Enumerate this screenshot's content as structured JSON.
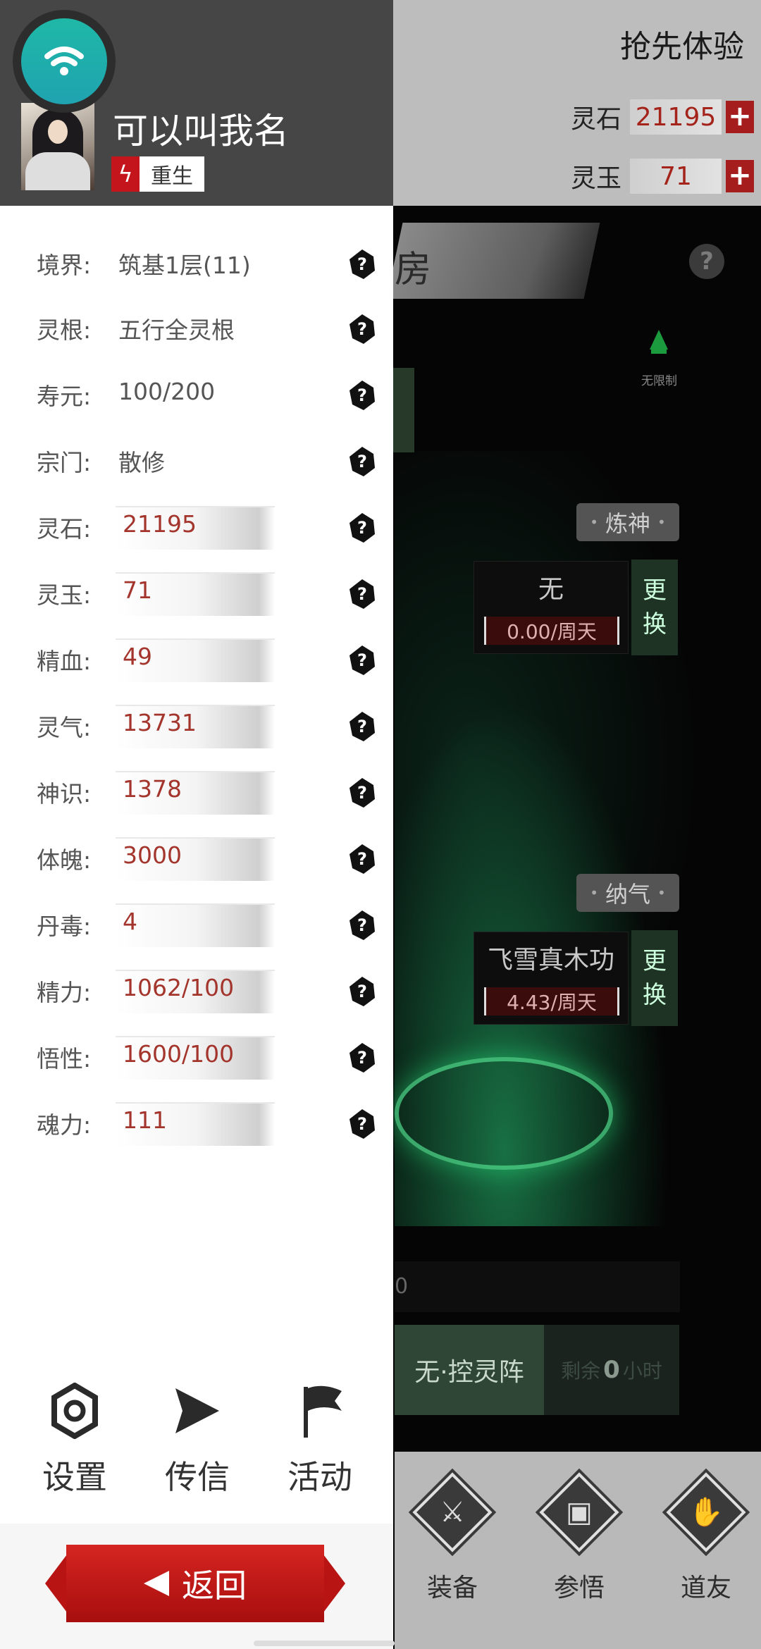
{
  "background": {
    "preview_label": "抢先体验",
    "resources": [
      {
        "label": "灵石",
        "value": "21195"
      },
      {
        "label": "灵玉",
        "value": "71"
      }
    ],
    "room_title": "房",
    "help_glyph": "?",
    "limit_label": "无限制",
    "tags": {
      "upper": "炼神",
      "lower": "纳气"
    },
    "slots": [
      {
        "name": "无",
        "rate": "0.00/周天",
        "swap": [
          "更",
          "换"
        ]
      },
      {
        "name": "飞雪真木功",
        "rate": "4.43/周天",
        "swap": [
          "更",
          "换"
        ]
      }
    ],
    "bar_text": "0",
    "array_button": "无·控灵阵",
    "remaining": {
      "prefix": "剩余",
      "value": "0",
      "suffix": "小时"
    },
    "bottom_nav": [
      {
        "label": "装备",
        "icon": "sword-icon"
      },
      {
        "label": "参悟",
        "icon": "book-icon"
      },
      {
        "label": "道友",
        "icon": "handshake-icon"
      }
    ]
  },
  "drawer": {
    "username": "可以叫我名",
    "rebirth_label": "重生",
    "stats": [
      {
        "label": "境界:",
        "value": "筑基1层(11)",
        "highlight": false
      },
      {
        "label": "灵根:",
        "value": "五行全灵根",
        "highlight": false
      },
      {
        "label": "寿元:",
        "value": "100/200",
        "highlight": false
      },
      {
        "label": "宗门:",
        "value": "散修",
        "highlight": false
      },
      {
        "label": "灵石:",
        "value": "21195",
        "highlight": true
      },
      {
        "label": "灵玉:",
        "value": "71",
        "highlight": true
      },
      {
        "label": "精血:",
        "value": "49",
        "highlight": true
      },
      {
        "label": "灵气:",
        "value": "13731",
        "highlight": true
      },
      {
        "label": "神识:",
        "value": "1378",
        "highlight": true
      },
      {
        "label": "体魄:",
        "value": "3000",
        "highlight": true
      },
      {
        "label": "丹毒:",
        "value": "4",
        "highlight": true
      },
      {
        "label": "精力:",
        "value": "1062/100",
        "highlight": true
      },
      {
        "label": "悟性:",
        "value": "1600/100",
        "highlight": true
      },
      {
        "label": "魂力:",
        "value": "111",
        "highlight": true
      }
    ],
    "quick_actions": [
      {
        "label": "设置",
        "icon": "settings-icon"
      },
      {
        "label": "传信",
        "icon": "send-icon"
      },
      {
        "label": "活动",
        "icon": "flag-icon"
      }
    ],
    "return_label": "返回"
  }
}
